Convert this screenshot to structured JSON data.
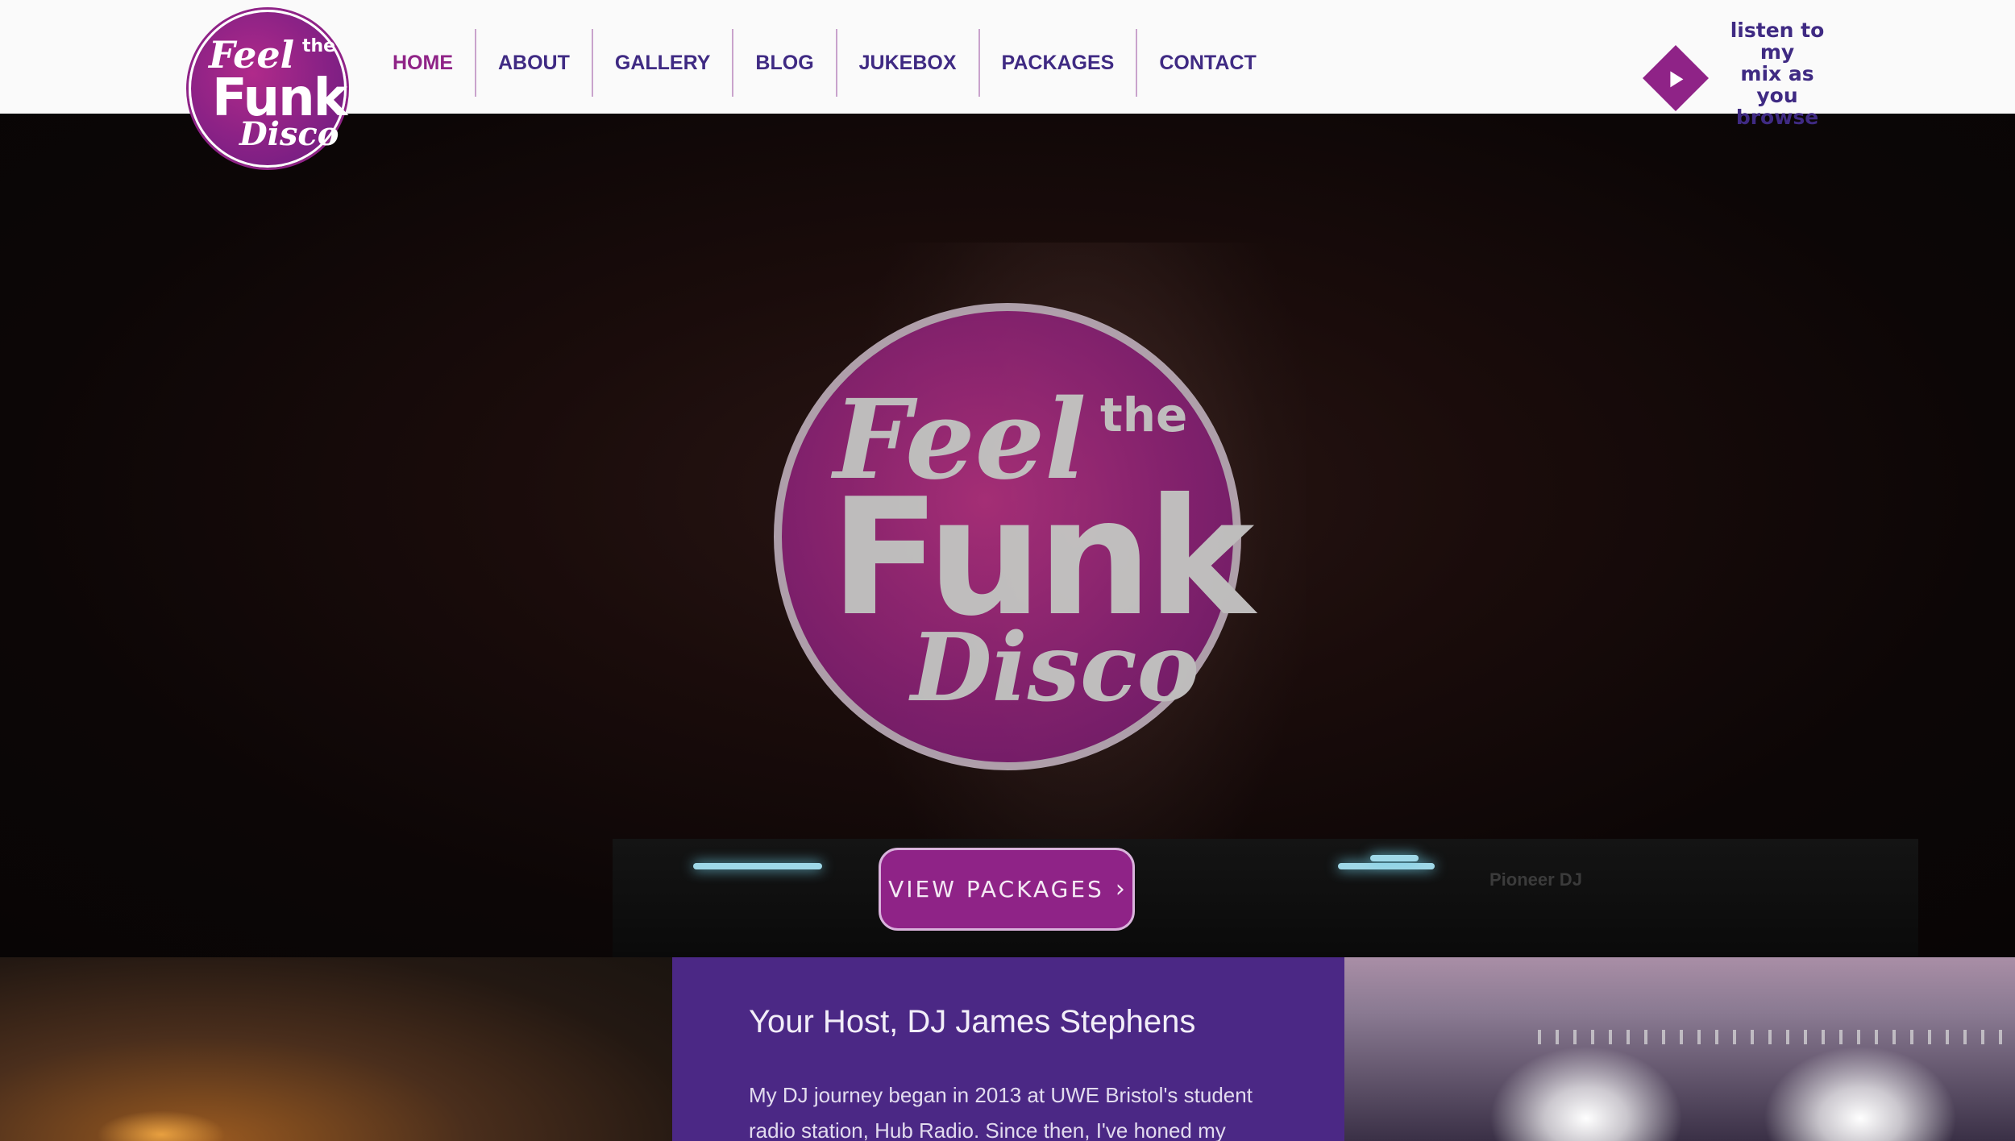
{
  "header": {
    "logo": {
      "feel": "Feel",
      "the": "the",
      "funk": "Funk",
      "disco": "Disco"
    },
    "nav": [
      {
        "label": "HOME",
        "active": true
      },
      {
        "label": "ABOUT"
      },
      {
        "label": "GALLERY"
      },
      {
        "label": "BLOG"
      },
      {
        "label": "JUKEBOX"
      },
      {
        "label": "PACKAGES"
      },
      {
        "label": "CONTACT"
      }
    ],
    "listen": {
      "line1": "listen to my",
      "line2": "mix as you",
      "line3": "browse",
      "icon": "play-icon"
    }
  },
  "hero": {
    "logo": {
      "feel": "Feel",
      "the": "the",
      "funk": "Funk",
      "disco": "Disco"
    },
    "deck_brand": "Pioneer DJ",
    "cta": {
      "label": "VIEW PACKAGES",
      "icon": "chevron-right-icon"
    }
  },
  "host": {
    "title": "Your Host, DJ James Stephens",
    "text": "My DJ journey began in 2013 at UWE Bristol's student radio station, Hub Radio. Since then, I've honed my"
  },
  "colors": {
    "accent": "#8f2387",
    "nav": "#3f2a83",
    "panel": "#4b2885"
  }
}
